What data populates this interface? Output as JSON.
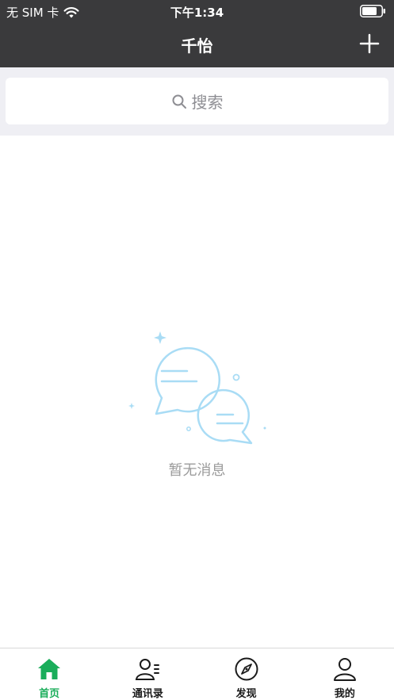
{
  "status_bar": {
    "carrier": "无 SIM 卡",
    "time": "下午1:34"
  },
  "nav": {
    "title": "千怡",
    "add_icon": "plus-icon"
  },
  "search": {
    "placeholder": "搜索",
    "icon": "search-icon"
  },
  "empty": {
    "message": "暂无消息",
    "illustration": "chat-bubbles-illustration"
  },
  "tabs": [
    {
      "label": "首页",
      "icon": "home-icon",
      "active": true
    },
    {
      "label": "通讯录",
      "icon": "contacts-icon",
      "active": false
    },
    {
      "label": "发现",
      "icon": "compass-icon",
      "active": false
    },
    {
      "label": "我的",
      "icon": "profile-icon",
      "active": false
    }
  ],
  "colors": {
    "header_bg": "#3a3a3c",
    "accent": "#1aad5a",
    "illustration": "#a9dcf5",
    "search_bg": "#efeff4"
  }
}
